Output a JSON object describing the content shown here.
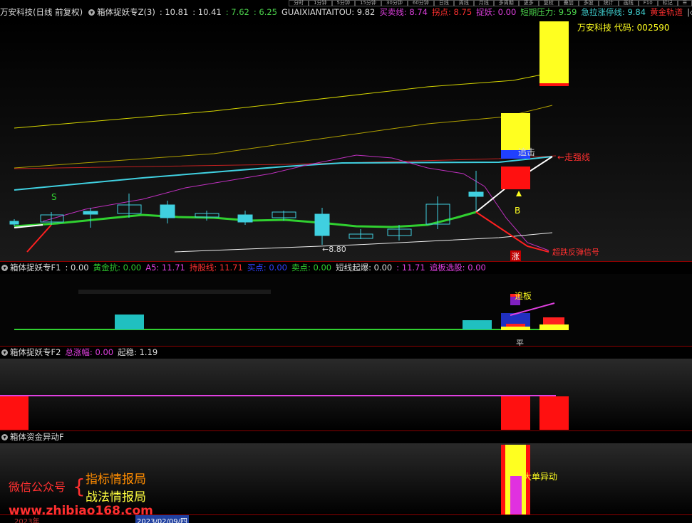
{
  "main": {
    "stock": "万安科技(日线 前复权)",
    "indicator": "箱体捉妖专Z(3)",
    "v1": ": 10.81",
    "v2": ": 10.41",
    "v3": ": 7.62",
    "v4": ": 6.25",
    "guaixian": "GUAIXIANTAITOU: 9.82",
    "maichu": "买卖线: 8.74",
    "qidian": "拐点: 8.75",
    "zhuoyao": "捉妖: 0.00",
    "duanqi": "短期压力: 9.59",
    "jila": "急拉涨停线: 9.84",
    "huangjin": "黄金轨道",
    "label_s": "S",
    "label_b": "B",
    "label_zhang": "涨",
    "label_zhuiji": "追击",
    "label_zouqiang": "←走强线",
    "label_low": "←8.80",
    "label_stockinfo": "万安科技 代码: 002590",
    "label_chao": "超跌反弹信号"
  },
  "f1": {
    "title": "箱体捉妖专F1",
    "v0": ": 0.00",
    "huangjinkang": "黄金抗: 0.00",
    "a5": "A5: 11.71",
    "chigu": "持股线: 11.71",
    "maidian": "买点: 0.00",
    "maidian2": "卖点: 0.00",
    "duanxian": "短线起爆: 0.00",
    "v11": ": 11.71",
    "zhuiban_xuan": "追板选股: 0.00",
    "label_zhuiban": "追板",
    "label_ping": "平"
  },
  "f2": {
    "title": "箱体捉妖专F2",
    "zongzhangfu": "总涨幅: 0.00",
    "qiwen": "起稳: 1.19"
  },
  "f3": {
    "title": "箱体资金异动F",
    "label_dadan": "大单异动"
  },
  "watermark": {
    "wechat": "微信公众号",
    "brace": "{",
    "line1": "指标情报局",
    "line2": "战法情报局",
    "url": "www.zhibiao168.com"
  },
  "axis": {
    "year": "2023年",
    "date": "2023/02/09/四"
  },
  "toolbar": [
    "分时",
    "1分钟",
    "5分钟",
    "15分钟",
    "30分钟",
    "60分钟",
    "日线",
    "周线",
    "月线",
    "多周期",
    "更多",
    "复权",
    "叠加",
    "多股",
    "统计",
    "画线",
    "F10",
    "标记",
    "☰"
  ]
}
